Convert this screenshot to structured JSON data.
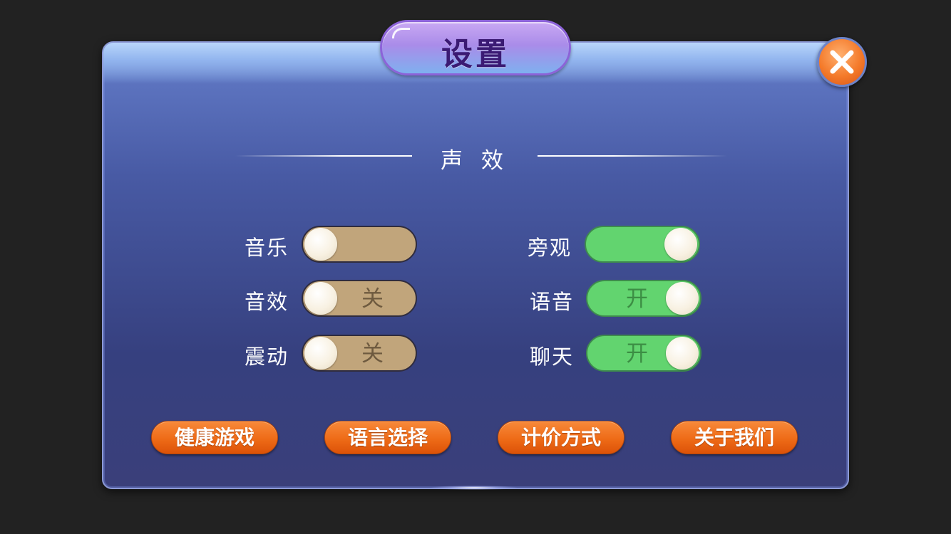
{
  "dialog": {
    "title": "设置",
    "close_icon": "close-x-icon"
  },
  "section": {
    "title": "声 效"
  },
  "settings": {
    "music": {
      "label": "音乐",
      "state": "off",
      "state_text": ""
    },
    "sound_effects": {
      "label": "音效",
      "state": "off",
      "state_text": "关"
    },
    "vibration": {
      "label": "震动",
      "state": "off",
      "state_text": "关"
    },
    "spectate": {
      "label": "旁观",
      "state": "on",
      "state_text": ""
    },
    "voice": {
      "label": "语音",
      "state": "on",
      "state_text": "开"
    },
    "chat": {
      "label": "聊天",
      "state": "on",
      "state_text": "开"
    }
  },
  "buttons": {
    "healthy_gaming": "健康游戏",
    "language_select": "语言选择",
    "pricing_method": "计价方式",
    "about_us": "关于我们"
  },
  "colors": {
    "toggle_off": "#c1a57b",
    "toggle_on": "#62d46f",
    "button_orange": "#ee6b17",
    "title_text": "#3b1a73"
  }
}
